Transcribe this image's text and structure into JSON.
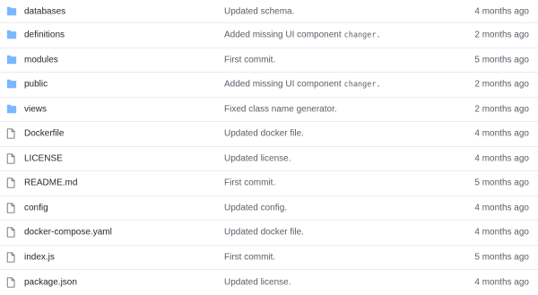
{
  "colors": {
    "folder_icon": "#79b8ff",
    "file_icon": "#6a737d",
    "text": "#24292e",
    "muted": "#586069",
    "divider": "#eaecef"
  },
  "rows": [
    {
      "type": "dir",
      "icon": "folder-icon",
      "name": "databases",
      "message": "Updated schema.",
      "code": "",
      "age": "4 months ago"
    },
    {
      "type": "dir",
      "icon": "folder-icon",
      "name": "definitions",
      "message": "Added missing UI component",
      "code": "changer.",
      "age": "2 months ago"
    },
    {
      "type": "dir",
      "icon": "folder-icon",
      "name": "modules",
      "message": "First commit.",
      "code": "",
      "age": "5 months ago"
    },
    {
      "type": "dir",
      "icon": "folder-icon",
      "name": "public",
      "message": "Added missing UI component",
      "code": "changer.",
      "age": "2 months ago"
    },
    {
      "type": "dir",
      "icon": "folder-icon",
      "name": "views",
      "message": "Fixed class name generator.",
      "code": "",
      "age": "2 months ago"
    },
    {
      "type": "file",
      "icon": "file-icon",
      "name": "Dockerfile",
      "message": "Updated docker file.",
      "code": "",
      "age": "4 months ago"
    },
    {
      "type": "file",
      "icon": "file-icon",
      "name": "LICENSE",
      "message": "Updated license.",
      "code": "",
      "age": "4 months ago"
    },
    {
      "type": "file",
      "icon": "file-icon",
      "name": "README.md",
      "message": "First commit.",
      "code": "",
      "age": "5 months ago"
    },
    {
      "type": "file",
      "icon": "file-icon",
      "name": "config",
      "message": "Updated config.",
      "code": "",
      "age": "4 months ago"
    },
    {
      "type": "file",
      "icon": "file-icon",
      "name": "docker-compose.yaml",
      "message": "Updated docker file.",
      "code": "",
      "age": "4 months ago"
    },
    {
      "type": "file",
      "icon": "file-icon",
      "name": "index.js",
      "message": "First commit.",
      "code": "",
      "age": "5 months ago"
    },
    {
      "type": "file",
      "icon": "file-icon",
      "name": "package.json",
      "message": "Updated license.",
      "code": "",
      "age": "4 months ago"
    }
  ]
}
